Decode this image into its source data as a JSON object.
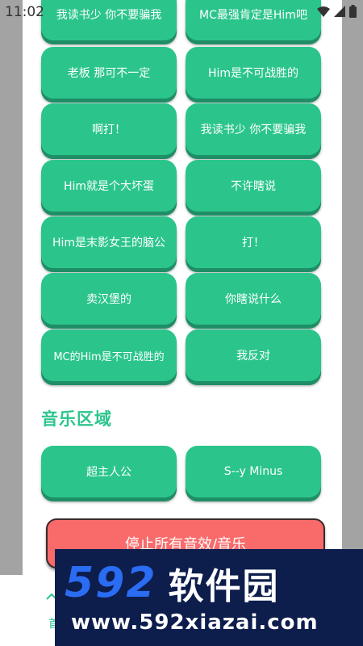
{
  "status_bar": {
    "time": "11:02",
    "icons": [
      "wifi-icon",
      "signal-icon",
      "battery-icon"
    ]
  },
  "sound_buttons": [
    {
      "label": "我读书少 你不要骗我"
    },
    {
      "label": "MC最强肯定是Him吧"
    },
    {
      "label": "老板 那可不一定"
    },
    {
      "label": "Him是不可战胜的"
    },
    {
      "label": "啊打！"
    },
    {
      "label": "我读书少 你不要骗我"
    },
    {
      "label": "Him就是个大坏蛋"
    },
    {
      "label": "不许瞎说"
    },
    {
      "label": "Him是末影女王的脑公"
    },
    {
      "label": "打！"
    },
    {
      "label": "卖汉堡的"
    },
    {
      "label": "你瞎说什么"
    },
    {
      "label": "MC的Him是不可战胜的"
    },
    {
      "label": "我反对"
    }
  ],
  "music_section": {
    "title": "音乐区域",
    "buttons": [
      {
        "label": "超主人公"
      },
      {
        "label": "S--y Minus"
      }
    ]
  },
  "stop_button": {
    "label": "停止所有音效/音乐"
  },
  "bottom_nav": {
    "home_label": "首"
  },
  "watermark": {
    "logo_number": "592",
    "logo_text": "软件园",
    "url": "www.592xiazai.com"
  },
  "colors": {
    "accent": "#2bc58c",
    "stop": "#f96a6a",
    "watermark_bg": "#0d1d4c",
    "watermark_blue": "#2a6cf2"
  }
}
